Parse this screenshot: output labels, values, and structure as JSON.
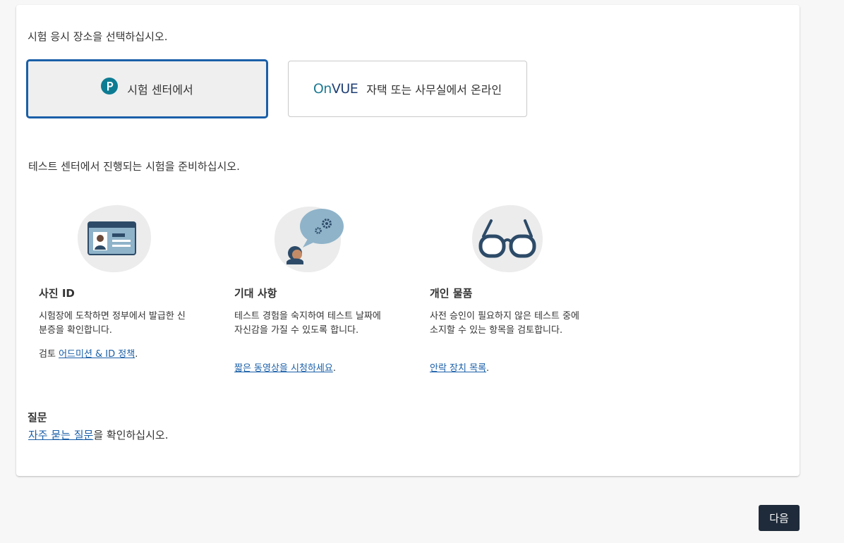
{
  "location": {
    "prompt": "시험 응시 장소을 선택하십시오.",
    "options": [
      {
        "label": "시험 센터에서",
        "selected": true,
        "icon": "pearson-p-icon"
      },
      {
        "label": "자택 또는 사무실에서 온라인",
        "selected": false,
        "logo_on": "On",
        "logo_vue": "VUE"
      }
    ]
  },
  "prep": {
    "heading": "테스트 센터에서 진행되는 시험을 준비하십시오.",
    "columns": [
      {
        "icon": "id-card-icon",
        "title": "사진 ID",
        "body": "시험장에 도착하면 정부에서 발급한 신분증을 확인합니다.",
        "link_prefix": "검토 ",
        "link_text": "어드미션 & ID 정책",
        "link_suffix": "."
      },
      {
        "icon": "speech-bubble-gears-icon",
        "title": "기대 사항",
        "body": "테스트 경험을 숙지하여 테스트 날짜에 자신감을 가질 수 있도록 합니다.",
        "link_prefix": "",
        "link_text": "짧은 동영상을 시청하세요",
        "link_suffix": "."
      },
      {
        "icon": "glasses-icon",
        "title": "개인 물품",
        "body": "사전 승인이 필요하지 않은 테스트 중에 소지할 수 있는 항목을 검토합니다.",
        "link_prefix": "",
        "link_text": "안락 장치 목록",
        "link_suffix": "."
      }
    ]
  },
  "faq": {
    "title": "질문",
    "link_text": "자주 묻는 질문",
    "suffix": "을 확인하십시오."
  },
  "footer": {
    "next_label": "다음"
  },
  "colors": {
    "accent": "#1a5fa8",
    "button_bg": "#1f2b3a",
    "onvue_teal": "#1f7a93",
    "onvue_navy": "#1f3f75"
  }
}
